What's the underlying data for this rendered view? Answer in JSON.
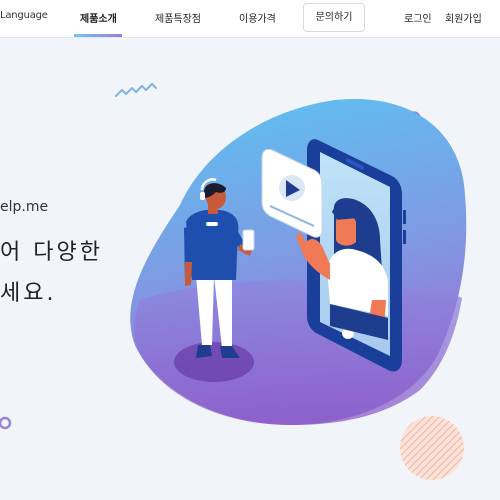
{
  "nav": {
    "language": "Language",
    "items": [
      "제품소개",
      "제품특장점",
      "이용가격"
    ],
    "active_index": 0,
    "inquiry": "문의하기",
    "login": "로그인",
    "join": "회원가입"
  },
  "hero": {
    "url_fragment": "elp.me",
    "headline_line1": "어 다양한",
    "headline_line2": "세요."
  },
  "colors": {
    "accent_blue": "#5cc3f2",
    "accent_purple": "#8c6bd6",
    "phone_navy": "#1a3f9a"
  }
}
